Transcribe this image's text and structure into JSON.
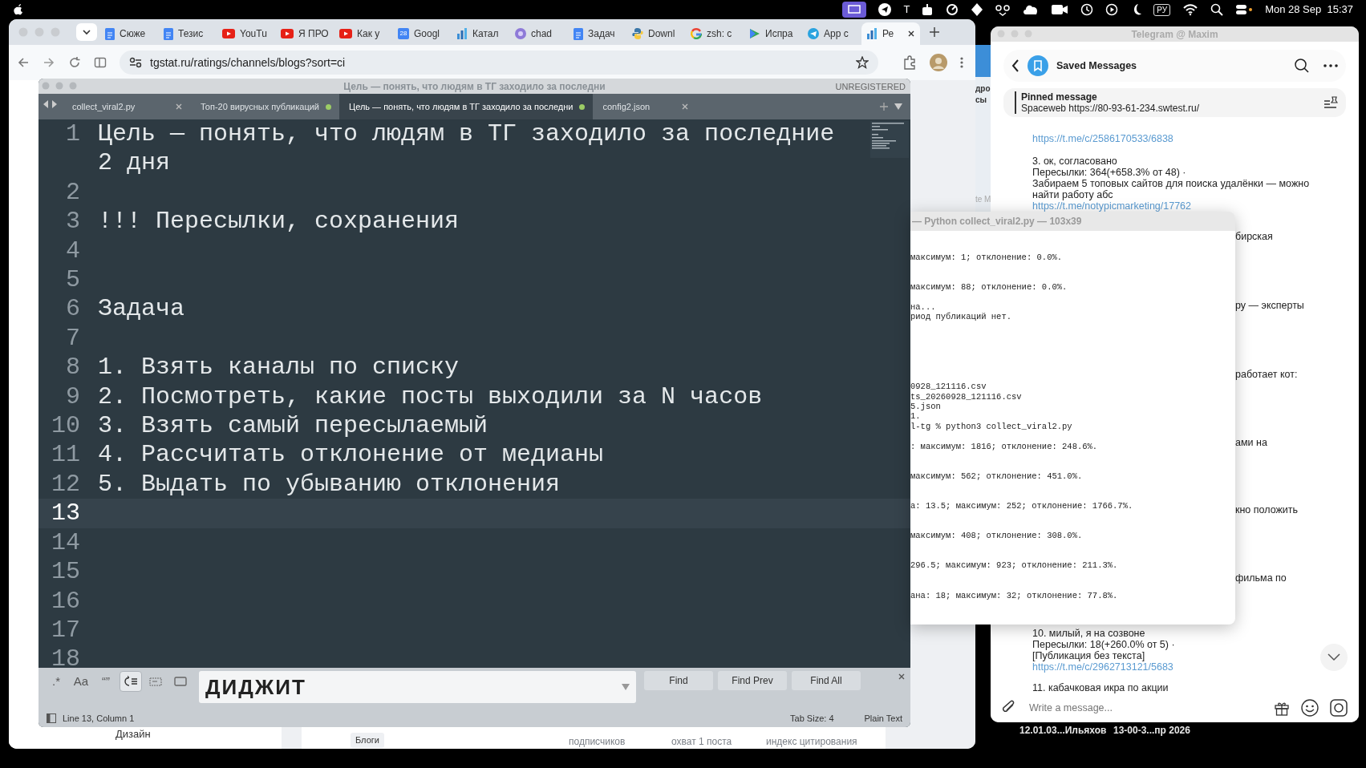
{
  "menu_bar": {
    "status_letter": "Т",
    "input_source": "РУ",
    "clock": "Mon 28 Sep  15:37"
  },
  "browser": {
    "tabs": [
      {
        "title": "Сюже",
        "selected": false
      },
      {
        "title": "Тезис",
        "selected": false
      },
      {
        "title": "YouTu",
        "selected": false
      },
      {
        "title": "Я ПРО",
        "selected": false
      },
      {
        "title": "Как у",
        "selected": false
      },
      {
        "title": "Googl",
        "badge": "28",
        "selected": false
      },
      {
        "title": "Катал",
        "selected": false
      },
      {
        "title": "chad",
        "selected": false
      },
      {
        "title": "Задач",
        "selected": false
      },
      {
        "title": "Downl",
        "selected": false
      },
      {
        "title": "zsh: c",
        "selected": false
      },
      {
        "title": "Испра",
        "selected": false
      },
      {
        "title": "App c",
        "selected": false
      },
      {
        "title": "Ре",
        "selected": true
      }
    ],
    "url": "tgstat.ru/ratings/channels/blogs?sort=ci",
    "page_fragments": [
      "Дизайн",
      "Блоги",
      "подписчиков",
      "охват 1 поста",
      "индекс цитирования"
    ]
  },
  "background_window": {
    "fragments": [
      "дро",
      "сы",
      "te M"
    ]
  },
  "editor": {
    "title": "Цель — понять, что людям в ТГ заходило за последни",
    "license": "UNREGISTERED",
    "tabs": [
      {
        "label": "collect_viral2.py",
        "modified": false,
        "selected": false
      },
      {
        "label": "Топ-20 вирусных публикаций",
        "modified": true,
        "selected": false
      },
      {
        "label": "Цель — понять, что людям в ТГ заходило за последни",
        "modified": true,
        "selected": true
      },
      {
        "label": "config2.json",
        "modified": false,
        "selected": false
      }
    ],
    "lines": [
      {
        "number": "1",
        "text": "Цель — понять, что людям в ТГ заходило за последние 2 дня",
        "current": false
      },
      {
        "number": "2",
        "current": false
      },
      {
        "number": "3",
        "text": "!!! Пересылки, сохранения",
        "current": false
      },
      {
        "number": "4",
        "current": false
      },
      {
        "number": "5",
        "current": false
      },
      {
        "number": "6",
        "text": "Задача",
        "current": false
      },
      {
        "number": "7",
        "current": false
      },
      {
        "number": "8",
        "text": "1. Взять каналы по списку",
        "current": false
      },
      {
        "number": "9",
        "text": "2. Посмотреть, какие посты выходили за N часов",
        "current": false
      },
      {
        "number": "10",
        "text": "3. Взять самый пересылаемый",
        "current": false
      },
      {
        "number": "11",
        "text": "4. Рассчитать отклонение от медианы",
        "current": false
      },
      {
        "number": "12",
        "text": "5. Выдать по убыванию отклонения",
        "current": false
      },
      {
        "number": "13",
        "current": true
      },
      {
        "number": "14",
        "current": false
      },
      {
        "number": "15",
        "current": false
      },
      {
        "number": "16",
        "current": false
      },
      {
        "number": "17",
        "current": false
      },
      {
        "number": "18",
        "current": false
      }
    ],
    "find": {
      "options": [
        {
          "kind": "regex",
          "label": ".*",
          "on": false
        },
        {
          "kind": "case",
          "label": "Aa",
          "on": false
        },
        {
          "kind": "word",
          "label": "“”",
          "on": false
        },
        {
          "kind": "wrap",
          "on": true
        },
        {
          "kind": "selection",
          "on": false
        },
        {
          "kind": "highlight",
          "on": false
        }
      ],
      "value": "ДИДЖИТ",
      "buttons": [
        "Find",
        "Find Prev",
        "Find All"
      ]
    },
    "status_bar": {
      "position": "Line 13, Column 1",
      "tab_size": "Tab Size: 4",
      "syntax": "Plain Text"
    }
  },
  "terminal": {
    "title": "— Python collect_viral2.py — 103x39",
    "lines": [
      "максимум: 1; отклонение: 0.0%.",
      "максимум: 88; отклонение: 0.0%.",
      "на...",
      "риод публикаций нет.",
      "0928_121116.csv",
      "ts_20260928_121116.csv",
      "5.json",
      "1.",
      "l-tg % python3 collect_viral2.py",
      ": максимум: 1816; отклонение: 248.6%.",
      "максимум: 562; отклонение: 451.0%.",
      "а: 13.5; максимум: 252; отклонение: 1766.7%.",
      "максимум: 408; отклонение: 308.0%.",
      "296.5; максимум: 923; отклонение: 211.3%.",
      "ана: 18; максимум: 32; отклонение: 77.8%."
    ]
  },
  "telegram": {
    "title": "Telegram @ Maxim",
    "chat": "Saved Messages",
    "pinned": {
      "label": "Pinned message",
      "text": "Spaceweb https://80-93-61-234.swtest.ru/"
    },
    "messages_top": [
      [
        {
          "kind": "link",
          "text": "https://t.me/c/2586170533/6838"
        }
      ],
      [
        {
          "kind": "text",
          "text": "3. ок, согласовано"
        },
        {
          "kind": "text",
          "text": "Пересылки: 364(+658.3% от 48) ·"
        },
        {
          "kind": "text",
          "text": "Забираем 5 топовых сайтов для поиска удалёнки — можно найти работу абс"
        },
        {
          "kind": "link",
          "text": "https://t.me/notypicmarketing/17762"
        }
      ]
    ],
    "fragments": [
      "бирская",
      "ру — эксперты",
      "работает кот:",
      "ами на",
      "кно положить",
      "фильма по"
    ],
    "messages_bottom": [
      [
        {
          "kind": "text",
          "text": "10. милый, я на созвоне"
        },
        {
          "kind": "text",
          "text": "Пересылки: 18(+260.0% от 5) ·"
        },
        {
          "kind": "text",
          "text": "[Публикация без текста]"
        },
        {
          "kind": "link",
          "text": "https://t.me/c/2962713121/5683"
        }
      ],
      [
        {
          "kind": "text",
          "text": "11. кабачковая икра по акции"
        }
      ]
    ],
    "composer": {
      "placeholder": "Write a message..."
    }
  },
  "desktop_files": [
    "12.01.03...Ильяхов",
    "13-00-3...пр 2026"
  ]
}
